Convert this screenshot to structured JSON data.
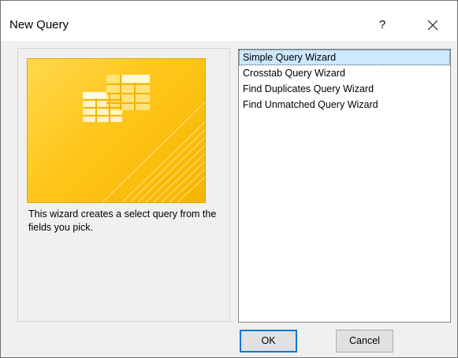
{
  "window": {
    "title": "New Query",
    "help_label": "?",
    "close_icon": "close-icon"
  },
  "description": "This wizard creates a select query from the fields you pick.",
  "wizards": [
    {
      "label": "Simple Query Wizard",
      "selected": true
    },
    {
      "label": "Crosstab Query Wizard",
      "selected": false
    },
    {
      "label": "Find Duplicates Query Wizard",
      "selected": false
    },
    {
      "label": "Find Unmatched Query Wizard",
      "selected": false
    }
  ],
  "buttons": {
    "ok_label": "OK",
    "cancel_label": "Cancel"
  },
  "colors": {
    "preview_yellow": "#ffc61a",
    "selection": "#cce8ff",
    "focus_border": "#0078d7"
  }
}
